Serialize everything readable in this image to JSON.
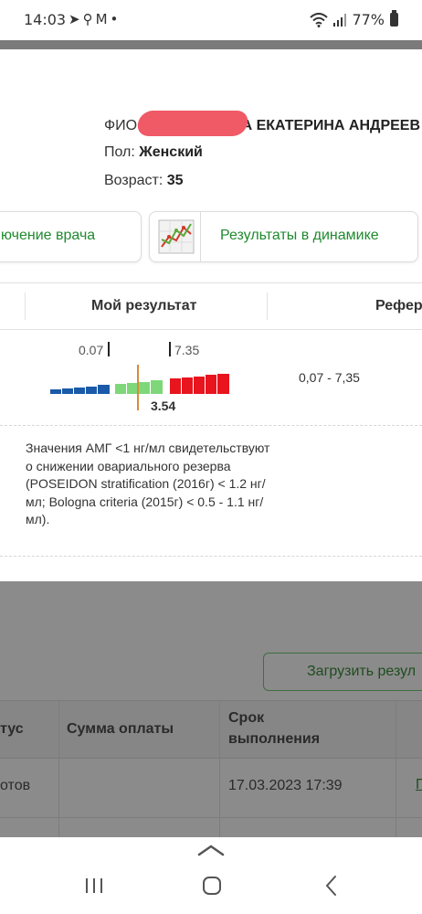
{
  "status_bar": {
    "time": "14:03",
    "icons": [
      "telegram-icon",
      "search-icon",
      "gmail-icon",
      "dot-icon"
    ],
    "battery": "77%"
  },
  "patient": {
    "fio_label": "ФИО:",
    "fio_value": "А ЕКАТЕРИНА АНДРЕЕВ",
    "sex_label": "Пол:",
    "sex_value": "Женский",
    "age_label": "Возраст:",
    "age_value": "35"
  },
  "cards": {
    "doctor_label": "ючение врача",
    "dynamics_label": "Результаты в динамике"
  },
  "result_table": {
    "col_my_result": "Мой результат",
    "col_reference": "Рефер",
    "scale_low": "0.07",
    "scale_high": "7.35",
    "result_value": "3.54",
    "reference_range": "0,07 - 7,35",
    "note": "Значения АМГ <1 нг/мл свидетельствуют о снижении овариального резерва (POSEIDON stratification (2016г) < 1.2 нг/мл; Bologna criteria (2015г) < 0.5 - 1.1 нг/мл)."
  },
  "orders": {
    "upload_button": "Загрузить резул",
    "headers": {
      "status": "тус",
      "payment": "Сумма оплаты",
      "deadline_1": "Срок",
      "deadline_2": "выполнения"
    },
    "row": {
      "status": "отов",
      "payment": "",
      "deadline": "17.03.2023 17:39",
      "link": "П"
    }
  },
  "colors": {
    "accent_green": "#1f8a2e",
    "bar_blue": "#1a5aa8",
    "bar_green": "#7ed87a",
    "bar_red": "#e8141e",
    "marker": "#d98a3a",
    "redaction": "#ef5a66"
  }
}
